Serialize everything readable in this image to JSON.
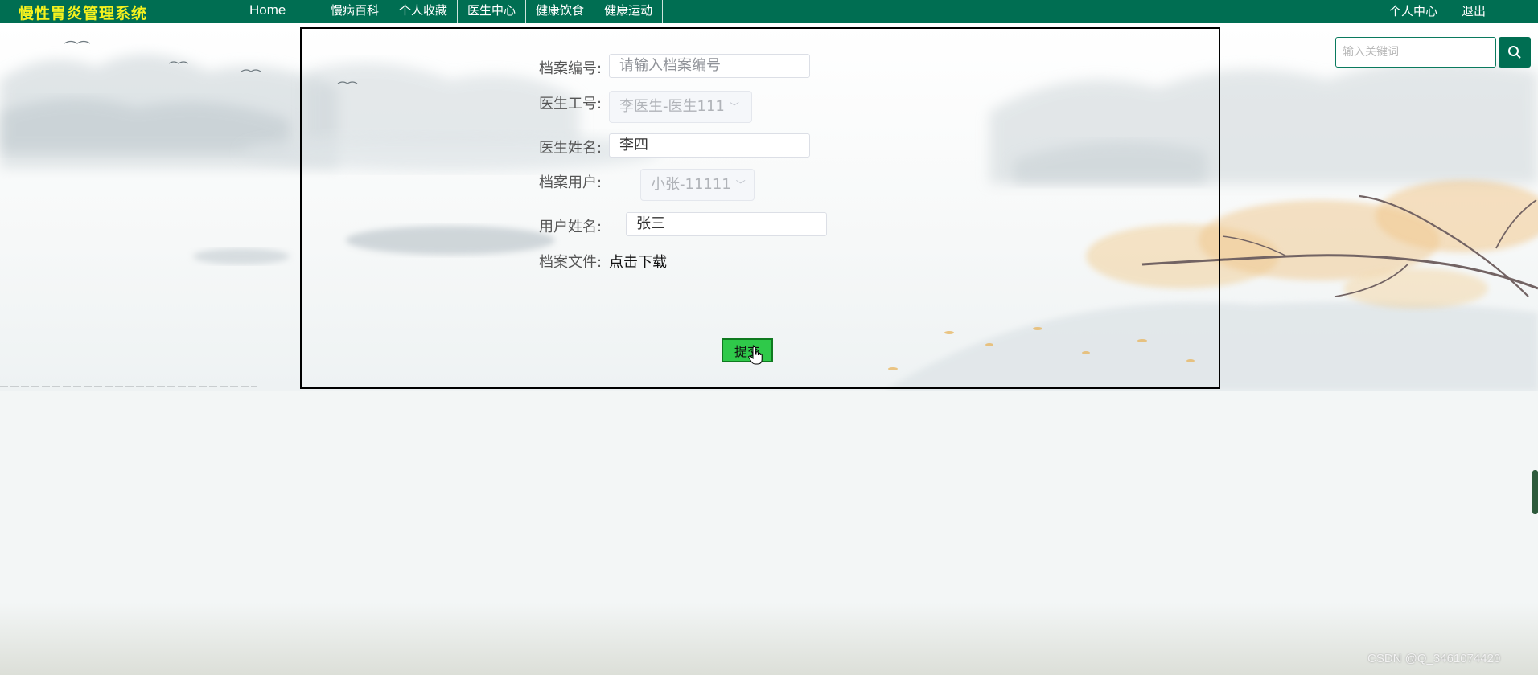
{
  "nav": {
    "brand": "慢性胃炎管理系统",
    "home": "Home",
    "items": [
      "慢病百科",
      "个人收藏",
      "医生中心",
      "健康饮食",
      "健康运动"
    ],
    "user_center": "个人中心",
    "logout": "退出"
  },
  "search": {
    "placeholder": "输入关键词",
    "icon": "search-icon"
  },
  "form": {
    "archive_no_label": "档案编号:",
    "archive_no_placeholder": "请输入档案编号",
    "doctor_id_label": "医生工号:",
    "doctor_id_value": "李医生-医生111",
    "doctor_name_label": "医生姓名:",
    "doctor_name_value": "李四",
    "archive_user_label": "档案用户:",
    "archive_user_value": "小张-11111",
    "user_name_label": "用户姓名:",
    "user_name_value": "张三",
    "archive_file_label": "档案文件:",
    "download_text": "点击下载",
    "submit_label": "提交"
  },
  "watermark": "CSDN @Q_3461074420",
  "colors": {
    "nav_bg": "#006e52",
    "brand_text": "#f5f11e",
    "submit_bg": "#2fc94a"
  }
}
